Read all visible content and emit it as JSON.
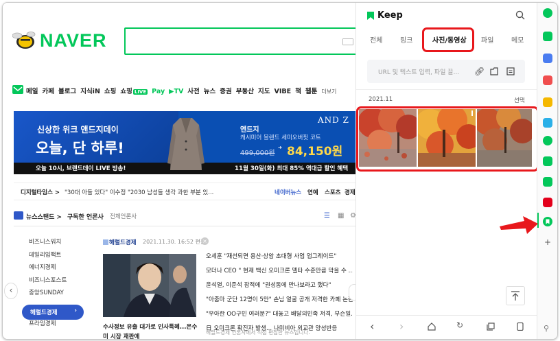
{
  "naver": {
    "logo": "NAVER",
    "nav_items": [
      {
        "label": "메일",
        "green": false
      },
      {
        "label": "카페",
        "green": false
      },
      {
        "label": "블로그",
        "green": false
      },
      {
        "label": "지식iN",
        "green": false
      },
      {
        "label": "쇼핑",
        "green": false
      },
      {
        "label": "쇼핑",
        "green": false
      },
      {
        "label": "LIVE",
        "green": true
      },
      {
        "label": "Pay",
        "green": true
      },
      {
        "label": "▶TV",
        "green": true
      },
      {
        "label": "사전",
        "green": false
      },
      {
        "label": "뉴스",
        "green": false
      },
      {
        "label": "증권",
        "green": false
      },
      {
        "label": "부동산",
        "green": false
      },
      {
        "label": "지도",
        "green": false
      },
      {
        "label": "VIBE",
        "green": false
      },
      {
        "label": "책",
        "green": false
      },
      {
        "label": "웹툰",
        "green": false
      },
      {
        "label": "더보기",
        "green": false
      }
    ],
    "banner": {
      "line1": "신상한 위크 앤드지데이",
      "line2": "오늘, 단 하루!",
      "live": "오늘 10시, 브랜드데이 LIVE 방송!",
      "brand": "앤드지",
      "product": "캐시미어 블렌드 세미오버핏 코트",
      "old_price": "499,000원",
      "new_price": "84,150원",
      "logo": "AND Z",
      "footer": "11월 30일(화) 최대 85% 역대급 할인 혜택"
    },
    "news_ticker": {
      "source": "디지털타임스 >",
      "headline": "\"30대 아들 있다\" 이수정 \"2030 남성들 생각 과한 부분 있...",
      "right_label": "네이버뉴스",
      "right_items": [
        "연예",
        "스포츠",
        "경제"
      ]
    },
    "newsstand": {
      "title": "뉴스스탠드 >",
      "subscribed": "구독한 언론사",
      "all": "전체언론사"
    },
    "press_list": [
      "비즈니스워치",
      "데일리임팩트",
      "에너지경제",
      "비즈니스포스트",
      "중앙SUNDAY",
      "헤럴드경제",
      "프라임경제"
    ],
    "press_active_index": 5,
    "article": {
      "press": "헤럴드경제",
      "timestamp": "2021.11.30. 16:52 편집",
      "caption_line1": "수사정보 유출 대가로 인사특혜...은수",
      "caption_line2": "미 시장 재판에",
      "headlines": [
        "오세훈 \"재선되면 용산·상암 초대형 사업 업그레이드\"",
        "모더나 CEO \" 현재 백신 오미크론 델타 수준만큼 막을 수 ...",
        "윤석열, 이준석 잠적에 \"권성동에 만나보라고 했다\"",
        "\"아줌마 군단 12명이 5만\" 손님 얼굴 공개 저격한 카페 논란",
        "\"우아한 OO구민 여러분?\" 대놓고 배달의민족 저격, 무슨일...",
        "日 오미크론 확진자 발생... 나미비아 외교관 양성반응"
      ],
      "footer": "헤럴드경제 언론사에서 직접 편집한 뉴스입니다."
    }
  },
  "keep": {
    "title": "Keep",
    "tabs": [
      "전체",
      "링크",
      "사진/동영상",
      "파일",
      "메모"
    ],
    "active_tab_index": 2,
    "input_placeholder": "URL 및 텍스트 입력, 파일 끌...",
    "month": "2021.11",
    "select_label": "선택",
    "photos": [
      "autumn-red-tree-photo",
      "autumn-orange-tree-photo",
      "autumn-maple-photo"
    ]
  },
  "colors": {
    "naver_green": "#03c75a",
    "highlight_red": "#e8181c",
    "banner_blue": "#0a4fb3",
    "active_press": "#2f58c8"
  }
}
